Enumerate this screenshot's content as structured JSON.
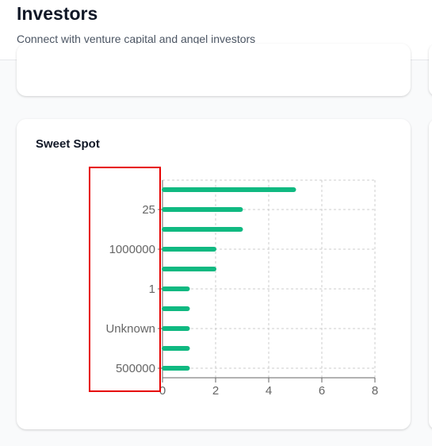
{
  "header": {
    "title": "Investors",
    "subtitle": "Connect with venture capital and angel investors"
  },
  "chart_card": {
    "title": "Sweet Spot"
  },
  "colors": {
    "bar": "#10b981",
    "highlight": "#e60000"
  },
  "chart_data": {
    "type": "bar",
    "orientation": "horizontal",
    "title": "Sweet Spot",
    "categories": [
      "",
      "25",
      "",
      "1000000",
      "",
      "1",
      "",
      "Unknown",
      "",
      "500000"
    ],
    "values": [
      5,
      3,
      3,
      2,
      2,
      1,
      1,
      1,
      1,
      1
    ],
    "xlim": [
      0,
      8
    ],
    "x_ticks": [
      0,
      2,
      4,
      6,
      8
    ],
    "grid": true
  }
}
